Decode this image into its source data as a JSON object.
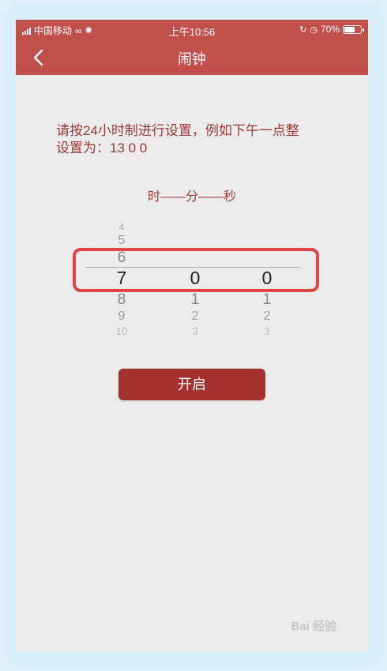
{
  "status_bar": {
    "carrier": "中国移动",
    "time": "上午10:56",
    "battery": "70%",
    "battery_level": 0.7
  },
  "nav": {
    "title": "闹钟",
    "back_icon": "chevron-left-icon"
  },
  "instruction": {
    "line1": "请按24小时制进行设置，例如下午一点整",
    "line2": "设置为：13 0 0"
  },
  "units_label": "时——分——秒",
  "picker": {
    "hour": {
      "above": [
        "4",
        "5",
        "6"
      ],
      "selected": "7",
      "below": [
        "8",
        "9",
        "10"
      ]
    },
    "minute": {
      "selected": "0",
      "below": [
        "1",
        "2",
        "3"
      ]
    },
    "second": {
      "selected": "0",
      "below": [
        "1",
        "2",
        "3"
      ]
    }
  },
  "start_button": "开启",
  "watermark": "Bai 经验",
  "colors": {
    "header": "#c0504b",
    "button": "#a3312e",
    "text_accent": "#9a3a34",
    "highlight": "#e04444",
    "background": "#ececec"
  }
}
